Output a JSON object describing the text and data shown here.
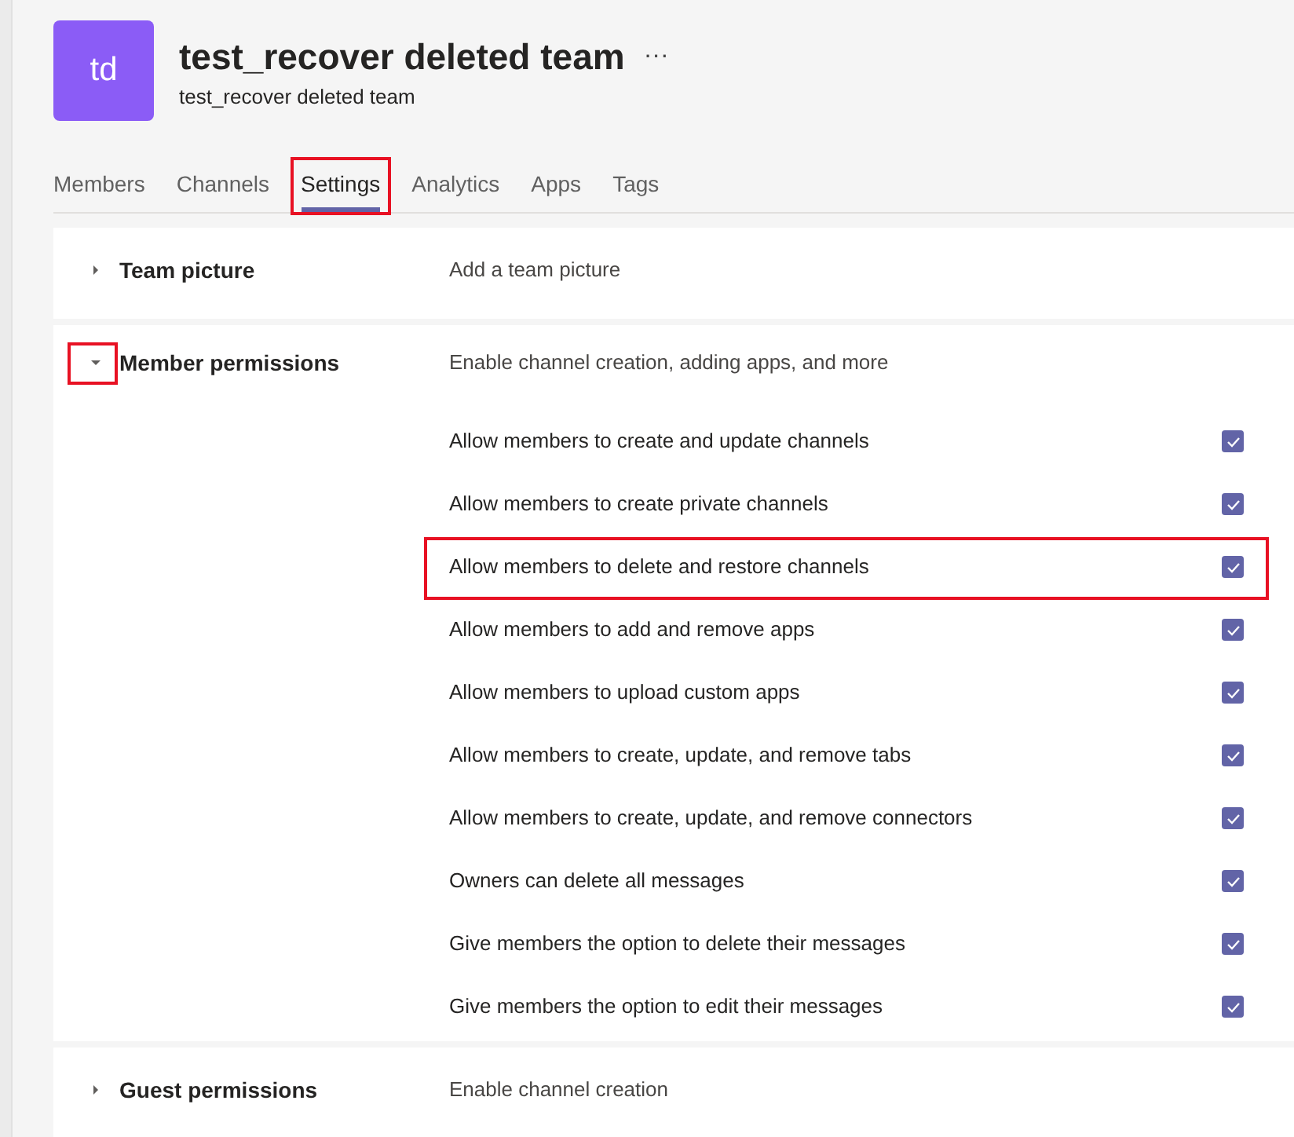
{
  "team": {
    "avatar": "td",
    "title": "test_recover deleted team",
    "more": "···",
    "subtitle": "test_recover deleted team"
  },
  "tabs": [
    {
      "label": "Members",
      "selected": false,
      "highlighted": false
    },
    {
      "label": "Channels",
      "selected": false,
      "highlighted": false
    },
    {
      "label": "Settings",
      "selected": true,
      "highlighted": true
    },
    {
      "label": "Analytics",
      "selected": false,
      "highlighted": false
    },
    {
      "label": "Apps",
      "selected": false,
      "highlighted": false
    },
    {
      "label": "Tags",
      "selected": false,
      "highlighted": false
    }
  ],
  "sections": [
    {
      "title": "Team picture",
      "description": "Add a team picture",
      "expanded": false,
      "highlighted": false
    },
    {
      "title": "Member permissions",
      "description": "Enable channel creation, adding apps, and more",
      "expanded": true,
      "highlighted": true,
      "options": [
        {
          "label": "Allow members to create and update channels",
          "checked": true,
          "highlighted": false
        },
        {
          "label": "Allow members to create private channels",
          "checked": true,
          "highlighted": false
        },
        {
          "label": "Allow members to delete and restore channels",
          "checked": true,
          "highlighted": true
        },
        {
          "label": "Allow members to add and remove apps",
          "checked": true,
          "highlighted": false
        },
        {
          "label": "Allow members to upload custom apps",
          "checked": true,
          "highlighted": false
        },
        {
          "label": "Allow members to create, update, and remove tabs",
          "checked": true,
          "highlighted": false
        },
        {
          "label": "Allow members to create, update, and remove connectors",
          "checked": true,
          "highlighted": false
        },
        {
          "label": "Owners can delete all messages",
          "checked": true,
          "highlighted": false
        },
        {
          "label": "Give members the option to delete their messages",
          "checked": true,
          "highlighted": false
        },
        {
          "label": "Give members the option to edit their messages",
          "checked": true,
          "highlighted": false
        }
      ]
    },
    {
      "title": "Guest permissions",
      "description": "Enable channel creation",
      "expanded": false,
      "highlighted": false
    }
  ]
}
